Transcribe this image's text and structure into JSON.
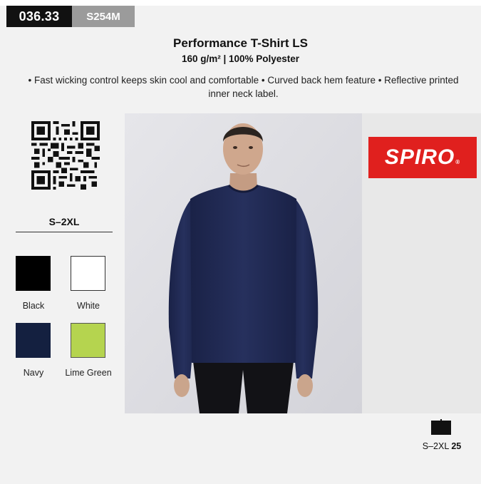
{
  "header": {
    "code_main": "036.33",
    "code_sub": "S254M"
  },
  "product": {
    "title": "Performance T-Shirt LS",
    "subtitle": "160 g/m² | 100% Polyester",
    "description": "• Fast wicking control keeps skin cool and comfortable • Curved back hem feature • Reflective printed inner neck label."
  },
  "sizes": "S–2XL",
  "colors": [
    {
      "name": "Black",
      "hex": "#000000"
    },
    {
      "name": "White",
      "hex": "#ffffff"
    },
    {
      "name": "Navy",
      "hex": "#142040"
    },
    {
      "name": "Lime Green",
      "hex": "#b5d44f"
    }
  ],
  "brand": {
    "name": "SPIRO",
    "color": "#e0201e"
  },
  "packaging": {
    "size_range": "S–2XL",
    "quantity": "25"
  }
}
